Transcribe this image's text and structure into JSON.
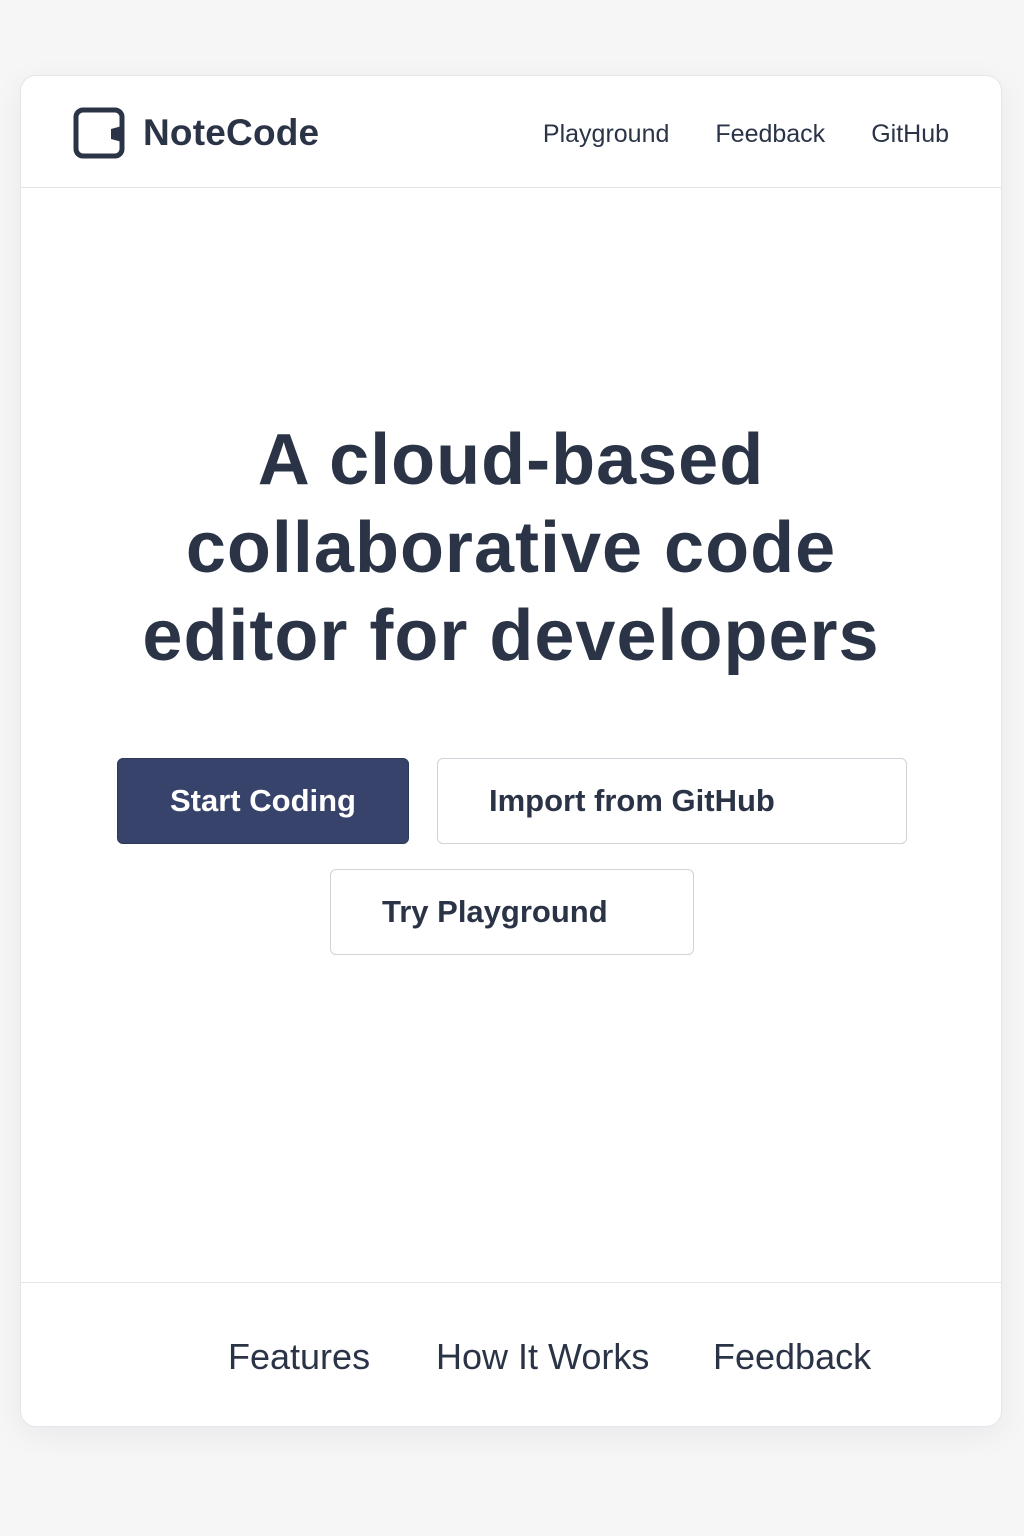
{
  "header": {
    "brand_name": "NoteCode",
    "logo_icon": "code-window-icon",
    "nav": [
      {
        "label": "Playground"
      },
      {
        "label": "Feedback"
      },
      {
        "label": "GitHub"
      }
    ]
  },
  "hero": {
    "title_lines": [
      "A cloud-based",
      "collaborative code",
      "editor for developers"
    ],
    "buttons": {
      "start_coding": "Start Coding",
      "import_github": "Import from GitHub",
      "try_playground": "Try Playground"
    }
  },
  "footer": {
    "links": [
      {
        "label": "Features"
      },
      {
        "label": "How It Works"
      },
      {
        "label": "Feedback"
      }
    ]
  },
  "colors": {
    "page_background": "#f6f6f7",
    "card_background": "#ffffff",
    "text": "#2b3447",
    "primary_button": "#37436a",
    "border": "#cfd3da"
  }
}
